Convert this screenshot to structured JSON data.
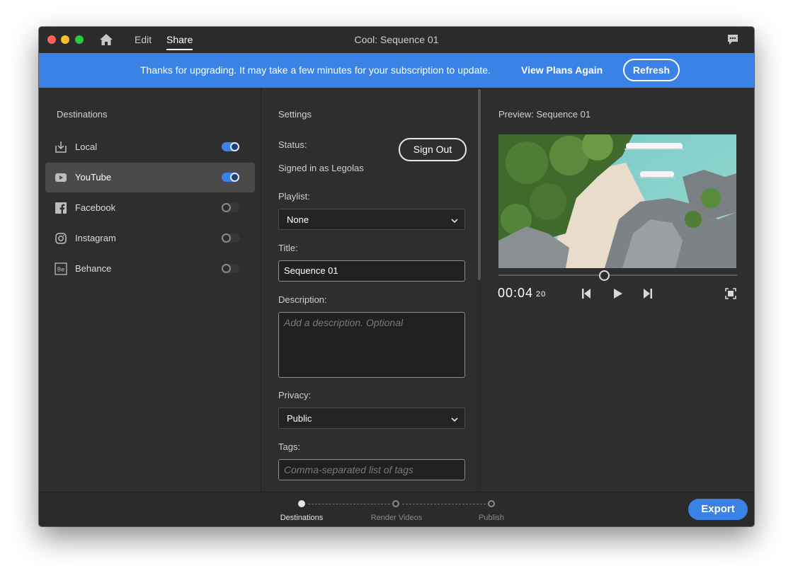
{
  "titlebar": {
    "menu_edit": "Edit",
    "menu_share": "Share",
    "title": "Cool: Sequence 01"
  },
  "banner": {
    "message": "Thanks for upgrading. It may take a few minutes for your subscription to update.",
    "link": "View Plans Again",
    "refresh": "Refresh",
    "color": "#3b82e6"
  },
  "destinations": {
    "heading": "Destinations",
    "items": [
      {
        "label": "Local",
        "icon": "download-icon",
        "enabled": true
      },
      {
        "label": "YouTube",
        "icon": "youtube-icon",
        "enabled": true,
        "selected": true
      },
      {
        "label": "Facebook",
        "icon": "facebook-icon",
        "enabled": false
      },
      {
        "label": "Instagram",
        "icon": "instagram-icon",
        "enabled": false
      },
      {
        "label": "Behance",
        "icon": "behance-icon",
        "enabled": false
      }
    ]
  },
  "settings": {
    "heading": "Settings",
    "status_label": "Status:",
    "signed_in": "Signed in as Legolas",
    "sign_out": "Sign Out",
    "playlist_label": "Playlist:",
    "playlist_value": "None",
    "title_label": "Title:",
    "title_value": "Sequence 01",
    "description_label": "Description:",
    "description_placeholder": "Add a description. Optional",
    "privacy_label": "Privacy:",
    "privacy_value": "Public",
    "tags_label": "Tags:",
    "tags_placeholder": "Comma-separated list of tags"
  },
  "preview": {
    "heading": "Preview: Sequence 01",
    "timecode": "00:04",
    "frames": "20",
    "playhead_fraction": 0.44
  },
  "footer": {
    "steps": [
      "Destinations",
      "Render Videos",
      "Publish"
    ],
    "active_step": 0,
    "export": "Export"
  }
}
